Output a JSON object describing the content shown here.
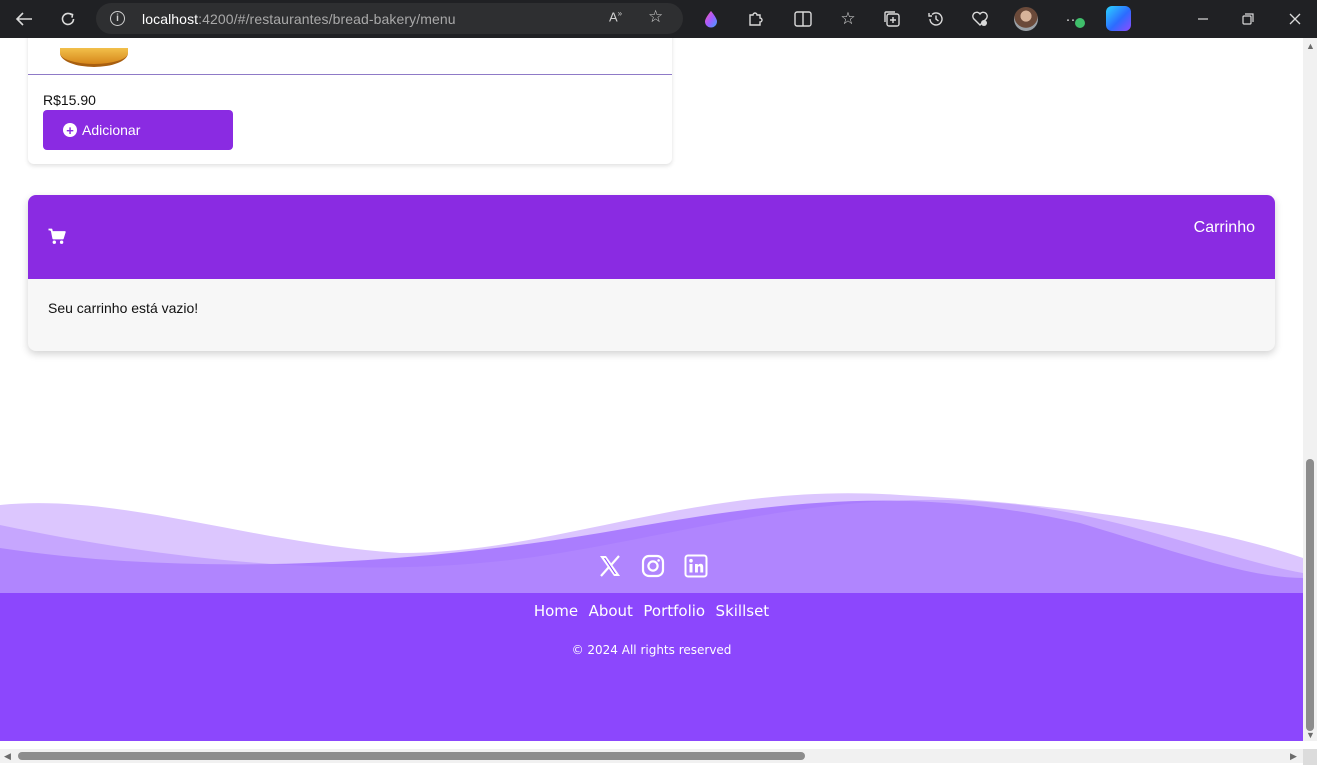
{
  "browser": {
    "url_host": "localhost",
    "url_rest": ":4200/#/restaurantes/bread-bakery/menu",
    "icons": [
      "back-icon",
      "refresh-icon",
      "info-icon",
      "read-aloud-icon",
      "favorite-star-icon",
      "drop-icon",
      "extensions-icon",
      "split-screen-icon",
      "favorites-icon",
      "collections-icon",
      "history-icon",
      "performance-icon",
      "profile-avatar",
      "more-icon",
      "copilot-icon",
      "minimize-icon",
      "restore-icon",
      "close-icon"
    ]
  },
  "product": {
    "price": "R$15.90",
    "add_label": "Adicionar"
  },
  "cart": {
    "title": "Carrinho",
    "empty_message": "Seu carrinho está vazio!"
  },
  "footer": {
    "social": [
      "x-icon",
      "instagram-icon",
      "linkedin-icon"
    ],
    "nav": [
      "Home",
      "About",
      "Portfolio",
      "Skillset"
    ],
    "copyright": "© 2024 All rights reserved"
  },
  "colors": {
    "brand": "#8a2be2",
    "footer": "#8c47fd",
    "chrome": "#202124"
  }
}
